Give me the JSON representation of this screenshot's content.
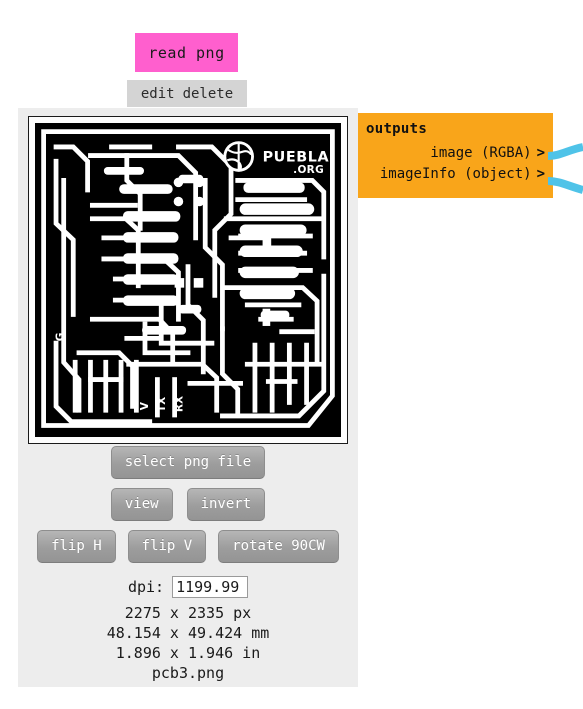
{
  "node": {
    "title": "read png",
    "title_color": "#ff5fce",
    "actions": [
      {
        "name": "edit",
        "label": "edit"
      },
      {
        "name": "delete",
        "label": "delete"
      }
    ],
    "body_color": "#ededed"
  },
  "preview": {
    "alt": "pcb3 png preview",
    "board_label_brand": "PUEBLA",
    "board_label_suffix": ".ORG",
    "board_pin_labels": [
      "G",
      "V",
      "TX",
      "RX"
    ],
    "background": "#000000",
    "trace_color": "#ffffff"
  },
  "controls": {
    "select_file": "select png file",
    "view": "view",
    "invert": "invert",
    "flip_h": "flip H",
    "flip_v": "flip V",
    "rotate_90cw": "rotate 90CW"
  },
  "dpi": {
    "label": "dpi:",
    "value": "1199.99"
  },
  "info": {
    "pixels": "2275 x 2335 px",
    "millimeters": "48.154 x 49.424 mm",
    "inches": "1.896 x 1.946 in",
    "filename": "pcb3.png"
  },
  "outputs": {
    "title": "outputs",
    "panel_color": "#f9a51a",
    "wire_color": "#4fc3e8",
    "ports": [
      {
        "name": "image",
        "label": "image (RGBA)",
        "arrow": ">"
      },
      {
        "name": "imageInfo",
        "label": "imageInfo (object)",
        "arrow": ">"
      }
    ]
  }
}
